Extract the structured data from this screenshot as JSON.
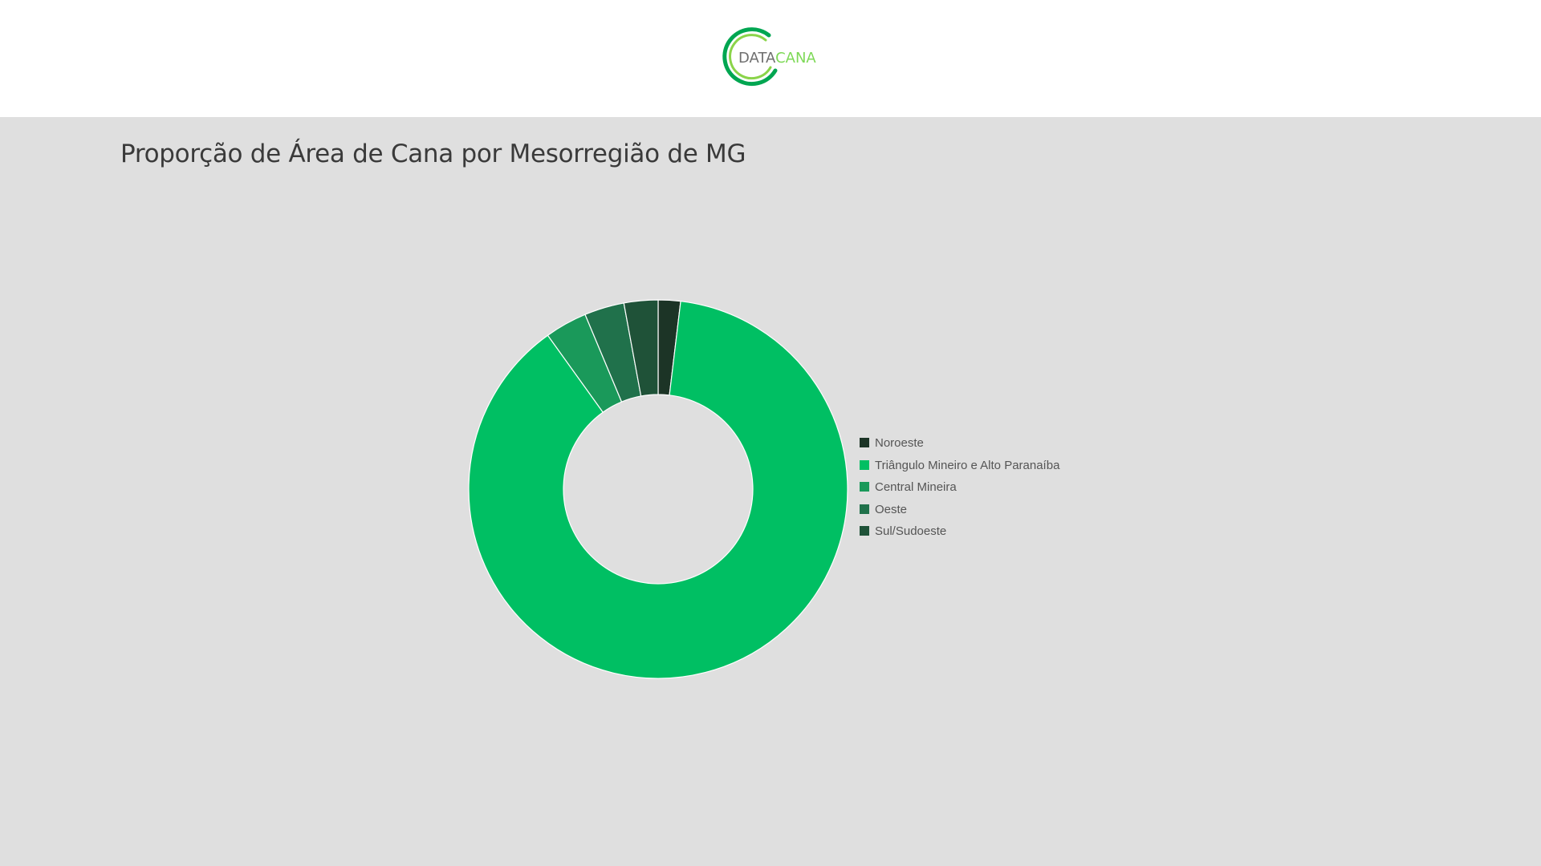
{
  "header": {
    "logo": {
      "text_part1": "DATA",
      "text_part2": "CANA",
      "colors": {
        "ring_outer": "#00a651",
        "ring_inner": "#8bd44a",
        "text_dark": "#6f6f6f",
        "text_green": "#7ed957"
      }
    }
  },
  "page": {
    "title": "Proporção de Área de Cana por Mesorregião de MG",
    "background": "#dfdfdf"
  },
  "chart_data": {
    "type": "pie",
    "variant": "donut",
    "title": "Proporção de Área de Cana por Mesorregião de MG",
    "legend_position": "right",
    "categories": [
      "Noroeste",
      "Triângulo Mineiro e Alto Paranaíba",
      "Central Mineira",
      "Oeste",
      "Sul/Sudoeste"
    ],
    "values": [
      1.9,
      88.2,
      3.6,
      3.4,
      2.9
    ],
    "unit": "%",
    "colors": [
      "#1c3426",
      "#00bf63",
      "#1a995a",
      "#20714b",
      "#1f5238"
    ]
  }
}
